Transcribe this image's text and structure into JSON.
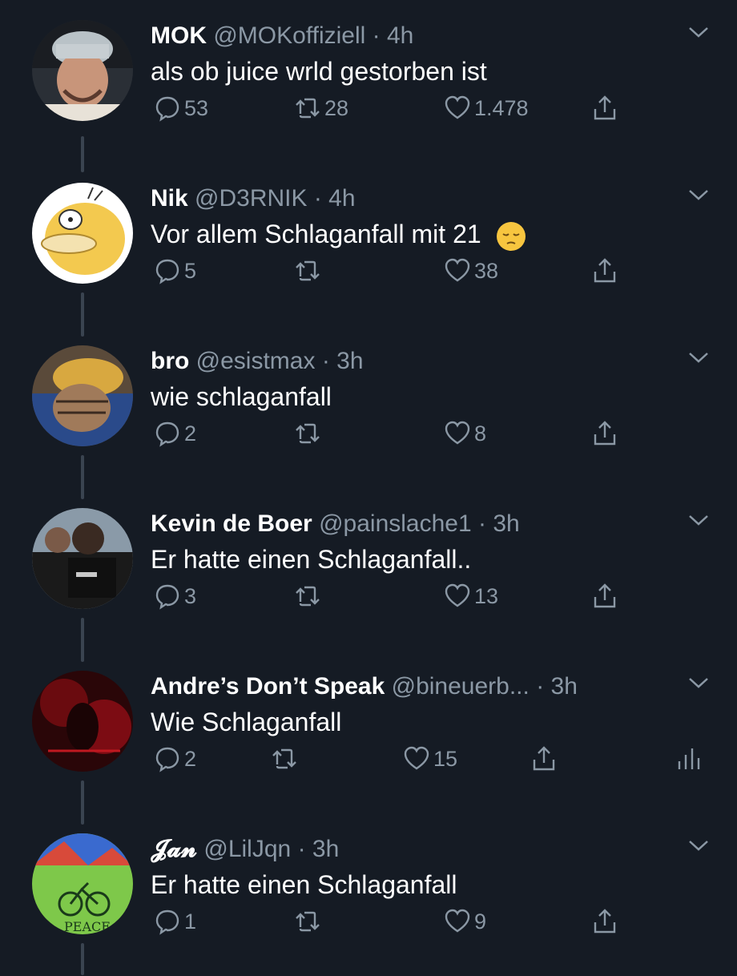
{
  "tweets": [
    {
      "name": "MOK",
      "handle": "@MOKoffiziell",
      "time": "· 4h",
      "text": "als ob juice wrld gestorben ist",
      "replies": "53",
      "retweets": "28",
      "likes": "1.478",
      "avatar": "avatar-man-cap"
    },
    {
      "name": "Nik",
      "handle": "@D3RNIK",
      "time": "· 4h",
      "text": "Vor allem Schlaganfall mit 21",
      "emoji": "pensive-face-icon",
      "replies": "5",
      "retweets": "",
      "likes": "38",
      "avatar": "avatar-psyduck"
    },
    {
      "name": "bro",
      "handle": "@esistmax",
      "time": "· 3h",
      "text": "wie schlaganfall",
      "replies": "2",
      "retweets": "",
      "likes": "8",
      "avatar": "avatar-anime"
    },
    {
      "name": "Kevin de Boer",
      "handle": "@painslache1",
      "time": "· 3h",
      "text": "Er hatte einen Schlaganfall..",
      "replies": "3",
      "retweets": "",
      "likes": "13",
      "avatar": "avatar-footballer"
    },
    {
      "name": "Andre’s Don’t Speak",
      "handle": "@bineuerb...",
      "time": "· 3h",
      "text": "Wie Schlaganfall",
      "replies": "2",
      "retweets": "",
      "likes": "15",
      "avatar": "avatar-red-dark"
    },
    {
      "name": "𝓙𝓪𝓷",
      "handle": "@LilJqn",
      "time": "· 3h",
      "text": "Er hatte einen Schlaganfall",
      "replies": "1",
      "retweets": "",
      "likes": "9",
      "avatar": "avatar-peace"
    }
  ],
  "colors": {
    "background": "#151b24",
    "text": "#ffffff",
    "secondary": "#8b98a5"
  }
}
